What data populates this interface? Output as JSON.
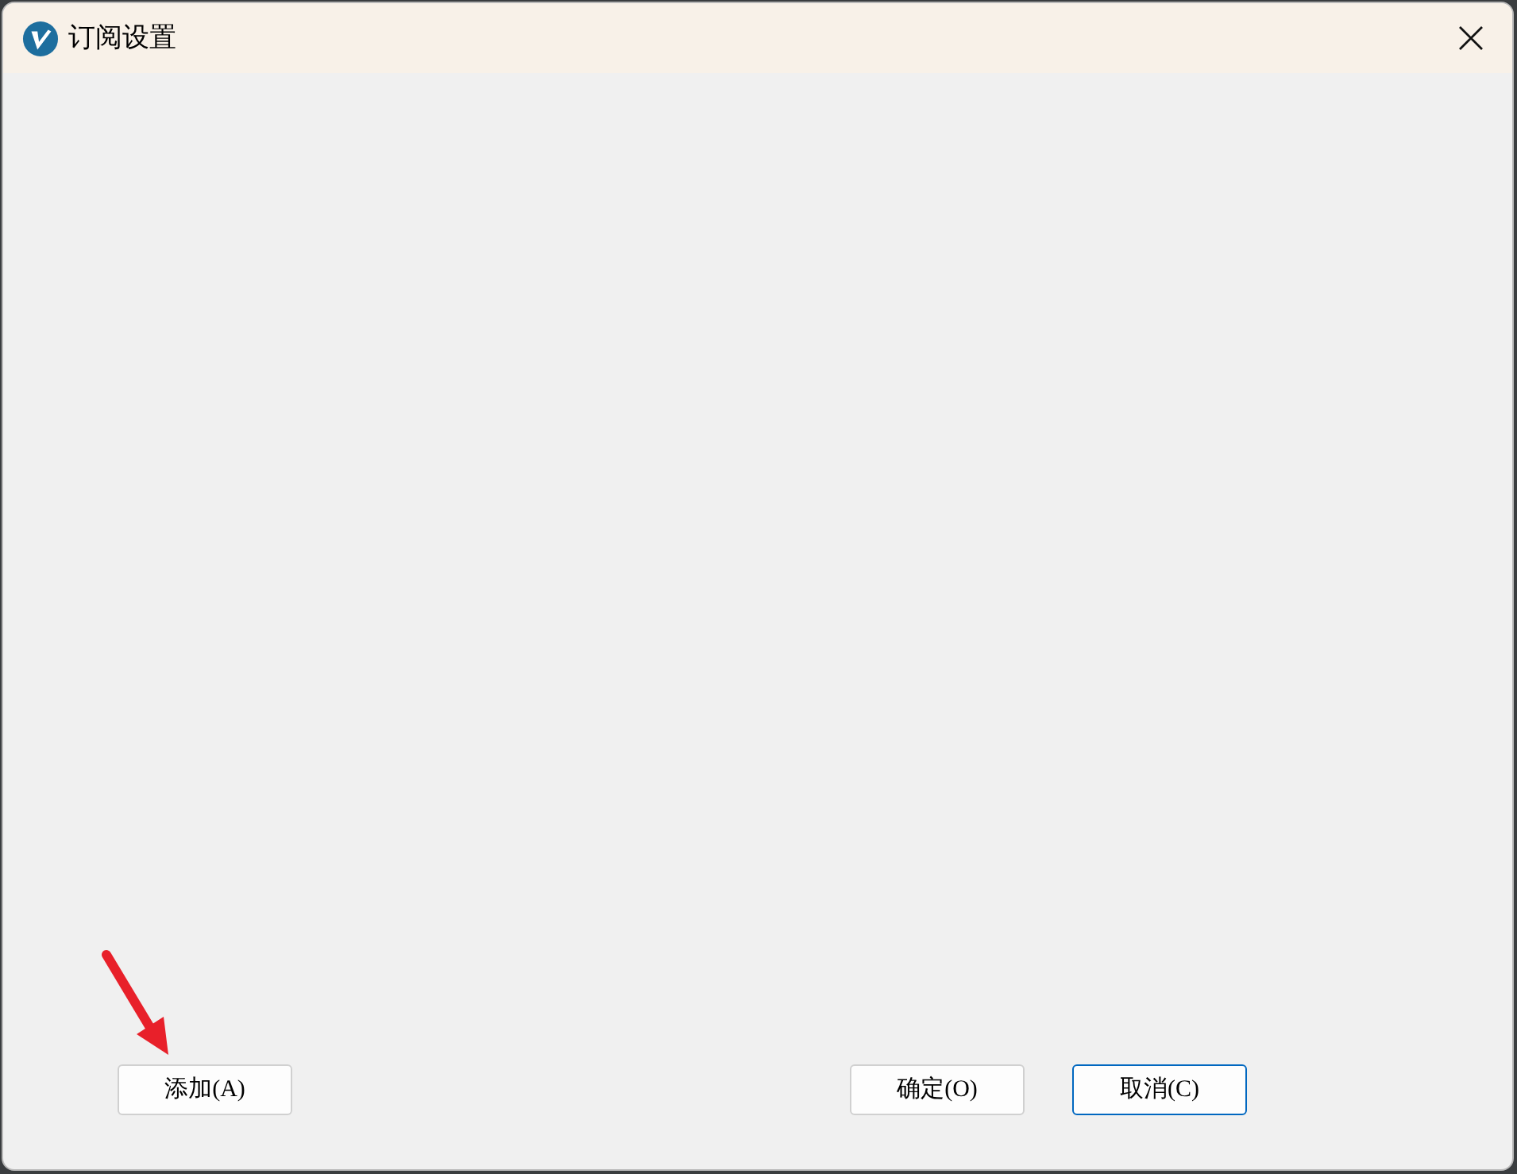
{
  "window": {
    "title": "订阅设置"
  },
  "left_buttons": [
    {
      "label": "添加(A)",
      "focused": false
    }
  ],
  "right_buttons": [
    {
      "label": "确定(O)",
      "focused": false
    },
    {
      "label": "取消(C)",
      "focused": true
    }
  ]
}
